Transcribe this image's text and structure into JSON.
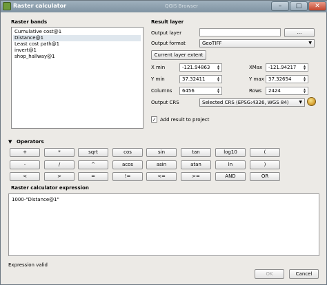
{
  "window": {
    "title": "Raster calculator",
    "background_title": "QGIS Browser"
  },
  "raster_bands": {
    "title": "Raster bands",
    "items": [
      {
        "label": "Cumulative cost@1"
      },
      {
        "label": "Distance@1"
      },
      {
        "label": "Least cost path@1"
      },
      {
        "label": "invert@1"
      },
      {
        "label": "shop_hallway@1"
      }
    ],
    "selected_index": 1
  },
  "result_layer": {
    "title": "Result layer",
    "output_layer_label": "Output layer",
    "output_layer_value": "",
    "browse_label": "...",
    "output_format_label": "Output format",
    "output_format_value": "GeoTIFF",
    "current_extent_label": "Current layer extent",
    "xmin_label": "X min",
    "xmin_value": "-121.94863",
    "xmax_label": "XMax",
    "xmax_value": "-121.94217",
    "ymin_label": "Y min",
    "ymin_value": "37.32411",
    "ymax_label": "Y max",
    "ymax_value": "37.32654",
    "columns_label": "Columns",
    "columns_value": "6456",
    "rows_label": "Rows",
    "rows_value": "2424",
    "crs_label": "Output CRS",
    "crs_value": "Selected CRS (EPSG:4326, WGS 84)",
    "add_result_label": "Add result to project",
    "add_result_checked": true
  },
  "operators": {
    "title": "Operators",
    "row1": [
      "+",
      "*",
      "sqrt",
      "cos",
      "sin",
      "tan",
      "log10",
      "("
    ],
    "row2": [
      "-",
      "/",
      "^",
      "acos",
      "asin",
      "atan",
      "ln",
      ")"
    ],
    "row3": [
      "<",
      ">",
      "=",
      "!=",
      "<=",
      ">=",
      "AND",
      "OR"
    ]
  },
  "expression": {
    "title": "Raster calculator expression",
    "value": "1000-\"Distance@1\""
  },
  "status": "Expression valid",
  "ok_label": "OK",
  "cancel_label": "Cancel",
  "icons": {
    "expand": "triangle-down-icon",
    "crs": "globe-icon",
    "check": "checkmark-icon"
  }
}
